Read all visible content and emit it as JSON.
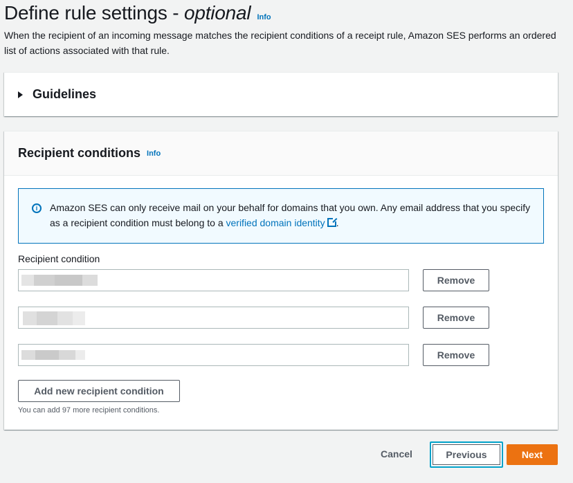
{
  "header": {
    "title": "Define rule settings - ",
    "title_optional": "optional",
    "info": "Info",
    "description": "When the recipient of an incoming message matches the recipient conditions of a receipt rule, Amazon SES performs an ordered list of actions associated with that rule."
  },
  "guidelines": {
    "label": "Guidelines"
  },
  "recipient_conditions": {
    "heading": "Recipient conditions",
    "info": "Info",
    "alert": {
      "text": "Amazon SES can only receive mail on your behalf for domains that you own. Any email address that you specify as a recipient condition must belong to a ",
      "link": "verified domain identity",
      "suffix": "."
    },
    "field_label": "Recipient condition",
    "conditions": [
      {
        "value": "",
        "remove_label": "Remove"
      },
      {
        "value": "",
        "remove_label": "Remove"
      },
      {
        "value": "",
        "remove_label": "Remove"
      }
    ],
    "add_label": "Add new recipient condition",
    "hint": "You can add 97 more recipient conditions."
  },
  "footer": {
    "cancel": "Cancel",
    "previous": "Previous",
    "next": "Next"
  },
  "colors": {
    "accent": "#0073bb",
    "primary_button": "#ec7211",
    "focus_ring": "#00a1c9"
  }
}
